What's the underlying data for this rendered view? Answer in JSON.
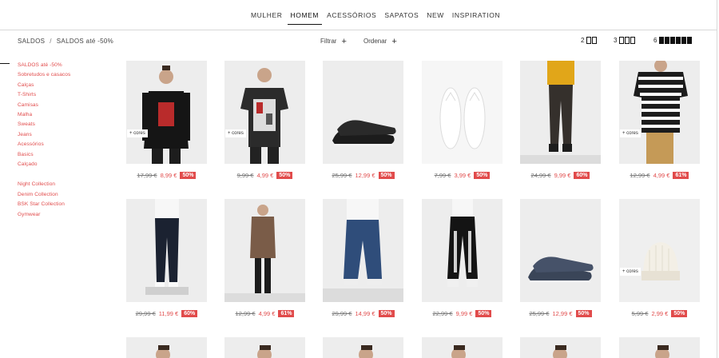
{
  "nav": {
    "items": [
      {
        "label": "MULHER",
        "active": false
      },
      {
        "label": "HOMEM",
        "active": true
      },
      {
        "label": "ACESSÓRIOS",
        "active": false
      },
      {
        "label": "SAPATOS",
        "active": false
      },
      {
        "label": "NEW",
        "active": false
      },
      {
        "label": "INSPIRATION",
        "active": false
      }
    ]
  },
  "breadcrumb": {
    "root": "SALDOS",
    "separator": "/",
    "current": "SALDOS até -50%"
  },
  "toolbar": {
    "filter_label": "Filtrar",
    "order_label": "Ordenar",
    "plus": "+",
    "grid_options": [
      {
        "count": "2",
        "squares": 2
      },
      {
        "count": "3",
        "squares": 3
      },
      {
        "count": "6",
        "squares": 6
      }
    ]
  },
  "sidebar": {
    "group1": [
      "SALDOS até -50%",
      "Sobretudos e casacos",
      "Calças",
      "T-Shirts",
      "Camisas",
      "Malha",
      "Sweats",
      "Jeans",
      "Acessórios",
      "Basics",
      "Calçado"
    ],
    "group2": [
      "Night Collection",
      "Denim Collection",
      "BSK Star Collection",
      "Gymwear"
    ]
  },
  "colors": {
    "accent": "#e14b4b",
    "text": "#222222",
    "image_bg": "#ececec"
  },
  "products": [
    {
      "name": "sweater-printed",
      "old": "17,99 €",
      "new": "8,99 €",
      "discount": "50%",
      "cores": "+ cores"
    },
    {
      "name": "tshirt-printed",
      "old": "9,99 €",
      "new": "4,99 €",
      "discount": "50%",
      "cores": "+ cores"
    },
    {
      "name": "sneakers-black",
      "old": "25,99 €",
      "new": "12,99 €",
      "discount": "50%",
      "cores": ""
    },
    {
      "name": "flip-flops-white",
      "old": "7,99 €",
      "new": "3,99 €",
      "discount": "50%",
      "cores": ""
    },
    {
      "name": "jogger-pants-black",
      "old": "24,99 €",
      "new": "9,99 €",
      "discount": "60%",
      "cores": ""
    },
    {
      "name": "striped-tshirt",
      "old": "12,99 €",
      "new": "4,99 €",
      "discount": "61%",
      "cores": "+ cores"
    },
    {
      "name": "jeans-dark",
      "old": "29,99 €",
      "new": "11,99 €",
      "discount": "60%",
      "cores": ""
    },
    {
      "name": "tshirt-brown",
      "old": "12,99 €",
      "new": "4,99 €",
      "discount": "61%",
      "cores": ""
    },
    {
      "name": "jeans-wide",
      "old": "29,99 €",
      "new": "14,99 €",
      "discount": "50%",
      "cores": ""
    },
    {
      "name": "jogger-print",
      "old": "22,99 €",
      "new": "9,99 €",
      "discount": "50%",
      "cores": ""
    },
    {
      "name": "sneakers-navy",
      "old": "25,99 €",
      "new": "12,99 €",
      "discount": "50%",
      "cores": ""
    },
    {
      "name": "beanie-cream",
      "old": "5,99 €",
      "new": "2,99 €",
      "discount": "50%",
      "cores": "+ cores"
    }
  ]
}
